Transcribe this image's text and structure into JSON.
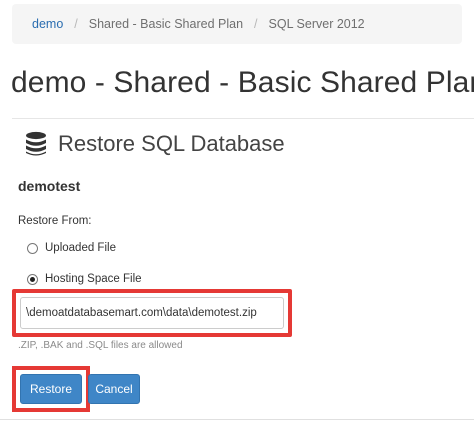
{
  "breadcrumb": {
    "items": [
      {
        "label": "demo",
        "link": true
      },
      {
        "label": "Shared - Basic Shared Plan",
        "link": false
      },
      {
        "label": "SQL Server 2012",
        "link": false
      }
    ],
    "separator": "/"
  },
  "page_title": "demo - Shared - Basic Shared Plan",
  "panel": {
    "icon": "database-icon",
    "title": "Restore SQL Database"
  },
  "database_name": "demotest",
  "restore_from": {
    "label": "Restore From:",
    "options": [
      {
        "label": "Uploaded File",
        "selected": false
      },
      {
        "label": "Hosting Space File",
        "selected": true
      }
    ]
  },
  "file_path": {
    "value": "\\demoatdatabasemart.com\\data\\demotest.zip"
  },
  "hint": ".ZIP, .BAK and .SQL files are allowed",
  "buttons": {
    "restore": "Restore",
    "cancel": "Cancel"
  },
  "colors": {
    "link": "#2a6db0",
    "button": "#3f86c7",
    "highlight": "#e53935"
  }
}
